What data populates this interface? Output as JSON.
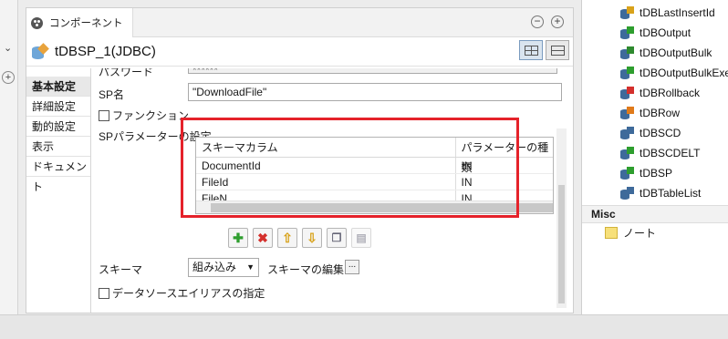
{
  "window": {
    "tab_title": "コンポーネント",
    "minimize_symbol": "−",
    "maximize_symbol": "+",
    "component_name": "tDBSP_1(JDBC)"
  },
  "sidenav": {
    "items": [
      {
        "label": "基本設定",
        "active": true
      },
      {
        "label": "詳細設定"
      },
      {
        "label": "動的設定"
      },
      {
        "label": "表示"
      },
      {
        "label": "ドキュメント"
      }
    ]
  },
  "form": {
    "password_label": "パスワード",
    "password_value": "******",
    "sp_name_label": "SP名",
    "sp_name_value": "\"DownloadFile\"",
    "function_label": "ファンクション",
    "sp_params_label": "SPパラメーターの設定",
    "table": {
      "headers": [
        "スキーマカラム",
        "パラメーターの種類"
      ],
      "rows": [
        [
          "DocumentId",
          "IN"
        ],
        [
          "FileId",
          "IN"
        ],
        [
          "FileN",
          "IN"
        ]
      ]
    },
    "schema_label": "スキーマ",
    "schema_value": "組み込み",
    "schema_edit_label": "スキーマの編集",
    "edit_button": "...",
    "datasource_alias_label": "データソースエイリアスの指定"
  },
  "palette": {
    "items": [
      "tDBLastInsertId",
      "tDBOutput",
      "tDBOutputBulk",
      "tDBOutputBulkExec",
      "tDBRollback",
      "tDBRow",
      "tDBSCD",
      "tDBSCDELT",
      "tDBSP",
      "tDBTableList"
    ],
    "icon_accents": [
      "#d9a21a",
      "#2e9e2e",
      "#2e8a2e",
      "#2e9e2e",
      "#d4302c",
      "#e07a1a",
      "#3e6a9a",
      "#2e9e2e",
      "#2e9e2e",
      "#3e6a9a"
    ],
    "misc_header": "Misc",
    "note_label": "ノート"
  },
  "colors": {
    "highlight": "#e5222a",
    "active_tab_bg": "#d9e4ef"
  }
}
